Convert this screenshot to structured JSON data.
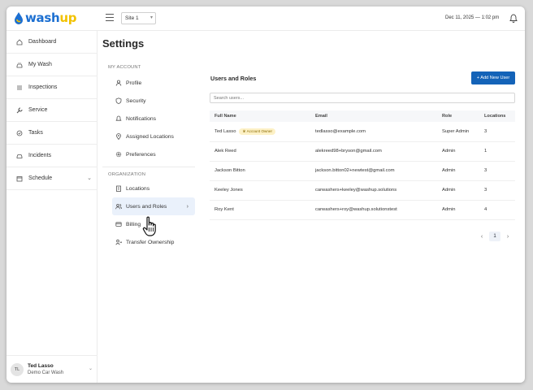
{
  "app": {
    "logo_main": "wash",
    "logo_accent": "up"
  },
  "topbar": {
    "site_selected": "Site 1",
    "datetime": "Dec 11, 2025 — 1:02 pm"
  },
  "sidebar": {
    "items": [
      {
        "label": "Dashboard",
        "icon": "home-icon"
      },
      {
        "label": "My Wash",
        "icon": "car-wash-icon"
      },
      {
        "label": "Inspections",
        "icon": "list-icon"
      },
      {
        "label": "Service",
        "icon": "wrench-icon"
      },
      {
        "label": "Tasks",
        "icon": "check-circle-icon"
      },
      {
        "label": "Incidents",
        "icon": "car-icon"
      },
      {
        "label": "Schedule",
        "icon": "calendar-icon"
      }
    ],
    "user": {
      "initials": "TL",
      "name": "Ted Lasso",
      "org": "Demo Car Wash"
    }
  },
  "settings": {
    "title": "Settings",
    "my_account_label": "MY ACCOUNT",
    "my_account": [
      "Profile",
      "Security",
      "Notifications",
      "Assigned Locations",
      "Preferences"
    ],
    "organization_label": "ORGANIZATION",
    "organization": [
      "Locations",
      "Users and Roles",
      "Billing",
      "Transfer Ownership"
    ]
  },
  "users": {
    "title": "Users and Roles",
    "add_button": "+ Add New User",
    "search_placeholder": "Search users...",
    "columns": [
      "Full Name",
      "Email",
      "Role",
      "Locations"
    ],
    "owner_badge": "Account Owner",
    "rows": [
      {
        "name": "Ted Lasso",
        "email": "tedlasso@example.com",
        "role": "Super Admin",
        "locations": "3"
      },
      {
        "name": "Alek Reed",
        "email": "alekreed98+bryson@gmail.com",
        "role": "Admin",
        "locations": "1"
      },
      {
        "name": "Jackson Bitton",
        "email": "jackson.bitton02+newtest@gmail.com",
        "role": "Admin",
        "locations": "3"
      },
      {
        "name": "Keeley Jones",
        "email": "carwashers+keeley@washup.solutions",
        "role": "Admin",
        "locations": "3"
      },
      {
        "name": "Roy Kent",
        "email": "carwashers+roy@washup.solutionstest",
        "role": "Admin",
        "locations": "4"
      }
    ],
    "page": "1"
  },
  "colors": {
    "brand_blue": "#1c6fd1",
    "brand_yellow": "#f2c200",
    "button_blue": "#1463b8"
  }
}
